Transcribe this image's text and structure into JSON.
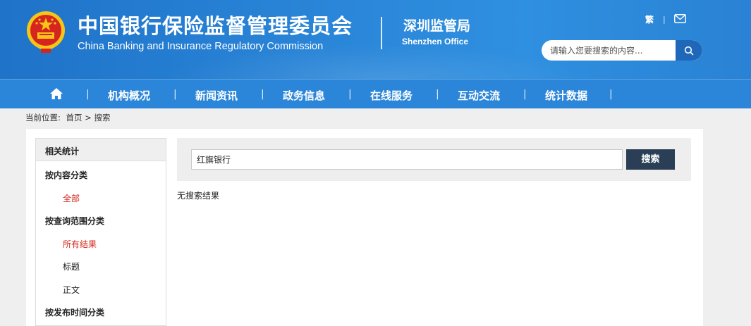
{
  "header": {
    "title_cn": "中国银行保险监督管理委员会",
    "title_en": "China Banking and Insurance Regulatory Commission",
    "office_cn": "深圳监管局",
    "office_en": "Shenzhen Office",
    "traditional_link": "繁",
    "separator": "|",
    "search_placeholder": "请输入您要搜索的内容...",
    "colors": {
      "header_blue": "#2a86d8",
      "search_button": "#1f67b8",
      "emblem_red": "#d6251f",
      "emblem_gold": "#f5c518"
    }
  },
  "nav": {
    "home_icon": "home-icon",
    "separator": "|",
    "items": [
      "机构概况",
      "新闻资讯",
      "政务信息",
      "在线服务",
      "互动交流",
      "统计数据"
    ]
  },
  "breadcrumb": {
    "label": "当前位置:",
    "path": "首页 > 搜索"
  },
  "sidebar": {
    "header": "相关统计",
    "groups": [
      {
        "label": "按内容分类",
        "items": [
          {
            "label": "全部",
            "active": true
          }
        ]
      },
      {
        "label": "按查询范围分类",
        "items": [
          {
            "label": "所有结果",
            "active": true
          },
          {
            "label": "标题",
            "active": false
          },
          {
            "label": "正文",
            "active": false
          }
        ]
      },
      {
        "label": "按发布时间分类",
        "items": []
      }
    ],
    "active_color": "#d42a1e"
  },
  "search": {
    "query": "红旗银行",
    "button_label": "搜索",
    "button_color": "#2a3f55"
  },
  "results": {
    "empty_message": "无搜索结果"
  }
}
